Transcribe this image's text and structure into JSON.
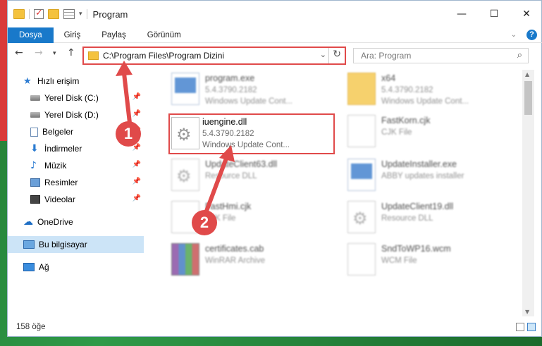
{
  "window": {
    "title": "Program"
  },
  "ribbon": {
    "tabs": [
      "Dosya",
      "Giriş",
      "Paylaş",
      "Görünüm"
    ]
  },
  "address": {
    "path": "C:\\Program Files\\Program Dizini"
  },
  "search": {
    "placeholder": "Ara: Program"
  },
  "sidebar": {
    "items": [
      {
        "label": "Hızlı erişim"
      },
      {
        "label": "Yerel Disk (C:)"
      },
      {
        "label": "Yerel Disk (D:)"
      },
      {
        "label": "Belgeler"
      },
      {
        "label": "İndirmeler"
      },
      {
        "label": "Müzik"
      },
      {
        "label": "Resimler"
      },
      {
        "label": "Videolar"
      },
      {
        "label": "OneDrive"
      },
      {
        "label": "Bu bilgisayar"
      },
      {
        "label": "Ağ"
      }
    ]
  },
  "files": [
    {
      "name": "program.exe",
      "line2": "5.4.3790.2182",
      "line3": "Windows Update Cont...",
      "icon": "exe-icon"
    },
    {
      "name": "x64",
      "line2": "5.4.3790.2182",
      "line3": "Windows Update Cont...",
      "icon": "folder-icon"
    },
    {
      "name": "FastKorn.cjk",
      "line2": "CJK File",
      "line3": "",
      "icon": "file-icon"
    },
    {
      "name": "iuengine.dll",
      "line2": "5.4.3790.2182",
      "line3": "Windows Update Cont...",
      "icon": "gear-file-icon"
    },
    {
      "name": "UpdateClient63.dll",
      "line2": "Resource DLL",
      "line3": "",
      "icon": "gear-file-icon"
    },
    {
      "name": "UpdateInstaller.exe",
      "line2": "ABBY updates installer",
      "line3": "",
      "icon": "exe-icon"
    },
    {
      "name": "FastHmi.cjk",
      "line2": "CJK File",
      "line3": "",
      "icon": "file-icon"
    },
    {
      "name": "UpdateClient19.dll",
      "line2": "Resource DLL",
      "line3": "",
      "icon": "gear-file-icon"
    },
    {
      "name": "certificates.cab",
      "line2": "WinRAR Archive",
      "line3": "",
      "icon": "rar-icon"
    },
    {
      "name": "SndToWP16.wcm",
      "line2": "WCM File",
      "line3": "",
      "icon": "file-icon"
    }
  ],
  "status": {
    "count": "158 öğe"
  },
  "annotations": {
    "step1": "1",
    "step2": "2"
  },
  "colors": {
    "accent": "#1979ca",
    "highlight": "#e04a4a",
    "selection": "#cce4f7"
  }
}
